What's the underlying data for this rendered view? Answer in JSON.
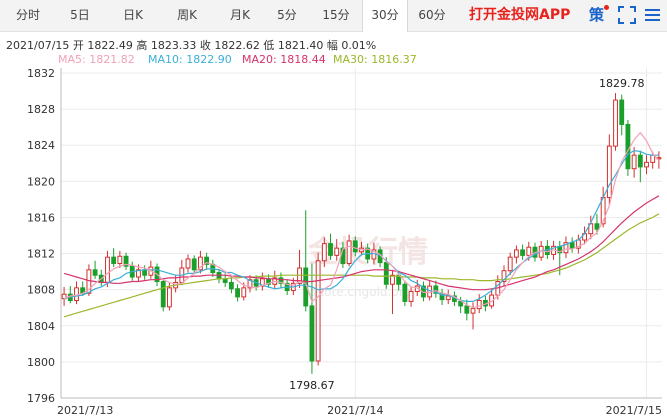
{
  "tabs": [
    {
      "label": "分时",
      "active": false
    },
    {
      "label": "5日",
      "active": false
    },
    {
      "label": "日K",
      "active": false
    },
    {
      "label": "周K",
      "active": false
    },
    {
      "label": "月K",
      "active": false
    },
    {
      "label": "5分",
      "active": false
    },
    {
      "label": "15分",
      "active": false
    },
    {
      "label": "30分",
      "active": true
    },
    {
      "label": "60分",
      "active": false
    }
  ],
  "brand": "打开金投网APP",
  "strategy_label": "策",
  "quote_line": "2021/07/15  开 1822.49  高 1823.33  收 1822.62  低 1821.40  幅 0.01%",
  "ma_legend": [
    {
      "label": "MA5: 1821.82",
      "color": "#f2a2b8"
    },
    {
      "label": "MA10: 1822.90",
      "color": "#3ab0d8"
    },
    {
      "label": "MA20: 1818.44",
      "color": "#d6336c"
    },
    {
      "label": "MA30: 1816.37",
      "color": "#9cb82c"
    }
  ],
  "watermark": {
    "text": "金投行情",
    "subtext": "quote.cngold.org"
  },
  "colors": {
    "up": "#d32f2f",
    "down": "#1a9f2a",
    "grid": "#ebebeb"
  },
  "chart_data": {
    "type": "candlestick",
    "ylim": [
      1796,
      1832
    ],
    "y_ticks": [
      "1832",
      "1828",
      "1824",
      "1820",
      "1816",
      "1812",
      "1808",
      "1804",
      "1800",
      "1796"
    ],
    "y_tick_values": [
      1832,
      1828,
      1824,
      1820,
      1816,
      1812,
      1808,
      1804,
      1800,
      1796
    ],
    "x_tick_labels": [
      "2021/7/13",
      "2021/7/14",
      "2021/7/15"
    ],
    "x_tick_index": [
      0,
      47,
      94
    ],
    "annotations": [
      {
        "text": "1829.78",
        "index": 90,
        "value": 1829.78
      },
      {
        "text": "1798.67",
        "index": 40,
        "value": 1798.67
      }
    ],
    "candles": [
      [
        1807.0,
        1807.5,
        1808.3,
        1806.2
      ],
      [
        1807.5,
        1806.8,
        1808.4,
        1806.5
      ],
      [
        1806.8,
        1808.2,
        1808.9,
        1806.4
      ],
      [
        1808.2,
        1807.6,
        1808.9,
        1807.3
      ],
      [
        1807.6,
        1810.2,
        1810.8,
        1807.3
      ],
      [
        1810.2,
        1809.6,
        1811.2,
        1809.2
      ],
      [
        1809.6,
        1808.8,
        1810.2,
        1808.4
      ],
      [
        1808.8,
        1811.6,
        1812.3,
        1808.3
      ],
      [
        1811.6,
        1810.9,
        1812.6,
        1810.5
      ],
      [
        1810.9,
        1811.7,
        1812.3,
        1810.4
      ],
      [
        1811.7,
        1810.6,
        1812.1,
        1810.2
      ],
      [
        1810.6,
        1809.4,
        1811.1,
        1809.0
      ],
      [
        1809.4,
        1810.2,
        1810.8,
        1808.9
      ],
      [
        1810.2,
        1809.6,
        1810.7,
        1809.1
      ],
      [
        1809.6,
        1810.5,
        1811.2,
        1809.2
      ],
      [
        1810.5,
        1808.9,
        1810.9,
        1808.4
      ],
      [
        1808.9,
        1806.1,
        1809.3,
        1805.6
      ],
      [
        1806.1,
        1808.2,
        1808.8,
        1805.7
      ],
      [
        1808.2,
        1808.8,
        1809.6,
        1807.7
      ],
      [
        1808.8,
        1810.4,
        1811.3,
        1808.5
      ],
      [
        1810.4,
        1811.4,
        1811.9,
        1809.9
      ],
      [
        1811.4,
        1810.2,
        1811.8,
        1809.7
      ],
      [
        1810.2,
        1811.6,
        1812.3,
        1809.8
      ],
      [
        1811.6,
        1810.8,
        1812.1,
        1810.2
      ],
      [
        1810.8,
        1809.9,
        1811.3,
        1809.4
      ],
      [
        1809.9,
        1809.2,
        1810.3,
        1808.7
      ],
      [
        1809.2,
        1808.8,
        1809.8,
        1808.3
      ],
      [
        1808.8,
        1808.1,
        1809.4,
        1807.6
      ],
      [
        1808.1,
        1807.2,
        1808.6,
        1806.7
      ],
      [
        1807.2,
        1808.2,
        1808.8,
        1806.8
      ],
      [
        1808.2,
        1809.1,
        1809.6,
        1807.7
      ],
      [
        1809.1,
        1808.4,
        1809.6,
        1807.9
      ],
      [
        1808.4,
        1809.2,
        1809.9,
        1807.9
      ],
      [
        1809.2,
        1808.6,
        1809.7,
        1808.2
      ],
      [
        1808.6,
        1809.3,
        1810.1,
        1808.1
      ],
      [
        1809.3,
        1808.7,
        1809.9,
        1808.2
      ],
      [
        1808.7,
        1807.9,
        1809.1,
        1807.4
      ],
      [
        1807.9,
        1808.7,
        1809.3,
        1807.4
      ],
      [
        1808.7,
        1810.4,
        1812.4,
        1808.2
      ],
      [
        1810.4,
        1806.2,
        1816.8,
        1805.6
      ],
      [
        1806.2,
        1800.1,
        1810.9,
        1798.67
      ],
      [
        1800.1,
        1811.2,
        1812.1,
        1799.6
      ],
      [
        1811.2,
        1813.1,
        1813.8,
        1810.5
      ],
      [
        1813.1,
        1811.8,
        1814.2,
        1811.3
      ],
      [
        1811.8,
        1812.6,
        1813.6,
        1811.2
      ],
      [
        1812.6,
        1810.9,
        1813.3,
        1810.4
      ],
      [
        1810.9,
        1813.4,
        1814.1,
        1810.6
      ],
      [
        1813.4,
        1812.2,
        1813.9,
        1811.7
      ],
      [
        1812.2,
        1812.6,
        1813.3,
        1811.8
      ],
      [
        1812.6,
        1811.4,
        1813.1,
        1810.9
      ],
      [
        1811.4,
        1812.4,
        1813.2,
        1810.8
      ],
      [
        1812.4,
        1811.0,
        1812.8,
        1810.5
      ],
      [
        1811.0,
        1808.6,
        1811.6,
        1808.1
      ],
      [
        1808.6,
        1809.6,
        1810.2,
        1805.3
      ],
      [
        1809.6,
        1808.6,
        1810.1,
        1807.9
      ],
      [
        1808.6,
        1806.7,
        1809.0,
        1806.2
      ],
      [
        1806.7,
        1807.8,
        1808.4,
        1806.1
      ],
      [
        1807.8,
        1808.4,
        1809.1,
        1807.3
      ],
      [
        1808.4,
        1807.2,
        1808.9,
        1806.7
      ],
      [
        1807.2,
        1808.4,
        1809.0,
        1806.8
      ],
      [
        1808.4,
        1807.6,
        1809.0,
        1807.1
      ],
      [
        1807.6,
        1806.9,
        1808.1,
        1806.3
      ],
      [
        1806.9,
        1807.3,
        1808.0,
        1806.4
      ],
      [
        1807.3,
        1806.7,
        1807.8,
        1806.2
      ],
      [
        1806.7,
        1806.2,
        1807.2,
        1805.4
      ],
      [
        1806.2,
        1805.4,
        1806.9,
        1804.6
      ],
      [
        1805.4,
        1805.9,
        1806.6,
        1803.6
      ],
      [
        1805.9,
        1806.8,
        1807.5,
        1805.4
      ],
      [
        1806.8,
        1806.2,
        1807.3,
        1805.6
      ],
      [
        1806.2,
        1807.4,
        1808.0,
        1805.9
      ],
      [
        1807.4,
        1808.9,
        1809.6,
        1806.9
      ],
      [
        1808.9,
        1810.1,
        1810.7,
        1808.4
      ],
      [
        1810.1,
        1811.6,
        1812.1,
        1809.6
      ],
      [
        1811.6,
        1812.4,
        1812.9,
        1810.9
      ],
      [
        1812.4,
        1811.8,
        1813.0,
        1811.3
      ],
      [
        1811.8,
        1812.7,
        1813.3,
        1811.2
      ],
      [
        1812.7,
        1811.6,
        1813.2,
        1811.1
      ],
      [
        1811.6,
        1812.8,
        1813.4,
        1811.2
      ],
      [
        1812.8,
        1811.9,
        1813.5,
        1811.4
      ],
      [
        1811.9,
        1812.8,
        1813.4,
        1811.3
      ],
      [
        1812.8,
        1812.1,
        1813.4,
        1809.6
      ],
      [
        1812.1,
        1813.2,
        1813.9,
        1811.5
      ],
      [
        1813.2,
        1812.6,
        1813.8,
        1812.1
      ],
      [
        1812.6,
        1813.5,
        1814.1,
        1812.0
      ],
      [
        1813.5,
        1814.2,
        1815.0,
        1813.0
      ],
      [
        1814.2,
        1815.3,
        1816.2,
        1813.6
      ],
      [
        1815.3,
        1814.7,
        1816.4,
        1814.1
      ],
      [
        1815.3,
        1818.2,
        1819.4,
        1814.9
      ],
      [
        1818.2,
        1823.9,
        1825.2,
        1817.4
      ],
      [
        1823.9,
        1829.0,
        1829.78,
        1823.4
      ],
      [
        1829.0,
        1826.3,
        1829.6,
        1825.1
      ],
      [
        1826.3,
        1821.4,
        1826.8,
        1820.6
      ],
      [
        1821.4,
        1822.9,
        1823.8,
        1820.4
      ],
      [
        1822.9,
        1821.6,
        1823.4,
        1819.9
      ],
      [
        1821.6,
        1822.1,
        1822.9,
        1820.8
      ],
      [
        1822.1,
        1822.9,
        1823.3,
        1821.4
      ],
      [
        1822.49,
        1822.62,
        1823.33,
        1821.4
      ]
    ],
    "ma5": [
      1807.0,
      1807.3,
      1807.4,
      1807.6,
      1808.0,
      1808.7,
      1809.2,
      1809.8,
      1810.3,
      1810.6,
      1810.8,
      1810.7,
      1810.5,
      1810.4,
      1810.1,
      1809.7,
      1809.1,
      1808.8,
      1808.6,
      1808.7,
      1809.3,
      1809.8,
      1810.5,
      1811.0,
      1810.8,
      1810.5,
      1810.0,
      1809.6,
      1809.0,
      1808.5,
      1808.3,
      1808.2,
      1808.5,
      1808.7,
      1808.9,
      1808.8,
      1808.6,
      1808.5,
      1808.9,
      1808.7,
      1806.7,
      1807.2,
      1808.1,
      1808.5,
      1810.2,
      1812.5,
      1812.8,
      1812.6,
      1812.4,
      1812.5,
      1812.2,
      1811.9,
      1811.1,
      1810.6,
      1809.7,
      1808.9,
      1808.3,
      1808.2,
      1807.7,
      1807.7,
      1807.9,
      1807.6,
      1807.5,
      1807.2,
      1806.8,
      1806.3,
      1806.0,
      1806.2,
      1806.4,
      1806.7,
      1807.3,
      1808.0,
      1809.1,
      1810.2,
      1811.0,
      1811.7,
      1812.1,
      1812.3,
      1812.2,
      1812.4,
      1812.2,
      1812.5,
      1812.5,
      1812.8,
      1813.1,
      1813.8,
      1814.3,
      1815.6,
      1817.3,
      1820.2,
      1822.2,
      1823.4,
      1824.6,
      1825.4,
      1824.5,
      1823.1,
      1822.3
    ],
    "ma10": [
      1807.0,
      1807.2,
      1807.3,
      1807.4,
      1807.7,
      1808.1,
      1808.3,
      1808.7,
      1809.1,
      1809.3,
      1809.8,
      1810.0,
      1810.1,
      1810.2,
      1810.2,
      1810.2,
      1810.0,
      1809.8,
      1809.6,
      1809.6,
      1809.8,
      1809.8,
      1810.0,
      1810.3,
      1810.3,
      1810.2,
      1809.9,
      1809.9,
      1809.6,
      1809.4,
      1809.0,
      1808.8,
      1808.5,
      1808.3,
      1808.1,
      1808.2,
      1808.3,
      1808.3,
      1808.5,
      1808.5,
      1808.3,
      1808.0,
      1808.1,
      1808.1,
      1808.5,
      1809.2,
      1810.3,
      1811.2,
      1811.9,
      1812.0,
      1812.0,
      1811.8,
      1811.2,
      1810.6,
      1809.9,
      1809.6,
      1809.0,
      1808.7,
      1808.2,
      1807.9,
      1807.7,
      1807.4,
      1807.4,
      1807.1,
      1806.8,
      1806.7,
      1806.7,
      1807.0,
      1807.4,
      1807.9,
      1808.5,
      1809.1,
      1809.8,
      1810.4,
      1811.0,
      1811.5,
      1811.9,
      1812.3,
      1812.4,
      1812.6,
      1812.8,
      1813.0,
      1813.3,
      1813.5,
      1814.2,
      1815.4,
      1816.8,
      1818.2,
      1819.6,
      1820.7,
      1821.9,
      1823.0,
      1823.4,
      1823.3,
      1823.0,
      1822.9,
      1822.9
    ],
    "ma20": [
      1809.8,
      1809.6,
      1809.4,
      1809.2,
      1809.0,
      1808.9,
      1808.8,
      1808.8,
      1808.7,
      1808.7,
      1808.8,
      1808.9,
      1808.9,
      1809.0,
      1809.1,
      1809.1,
      1809.2,
      1809.3,
      1809.3,
      1809.4,
      1809.4,
      1809.5,
      1809.5,
      1809.6,
      1809.6,
      1809.6,
      1809.6,
      1809.5,
      1809.5,
      1809.4,
      1809.4,
      1809.3,
      1809.3,
      1809.2,
      1809.2,
      1809.1,
      1809.1,
      1809.0,
      1809.0,
      1808.9,
      1808.9,
      1809.0,
      1809.1,
      1809.2,
      1809.3,
      1809.4,
      1809.6,
      1809.8,
      1810.0,
      1810.1,
      1810.2,
      1810.2,
      1810.2,
      1810.1,
      1810.0,
      1809.8,
      1809.6,
      1809.4,
      1809.2,
      1809.0,
      1808.8,
      1808.6,
      1808.4,
      1808.3,
      1808.2,
      1808.1,
      1808.0,
      1808.0,
      1808.0,
      1808.1,
      1808.2,
      1808.4,
      1808.6,
      1808.8,
      1809.0,
      1809.2,
      1809.4,
      1809.7,
      1810.0,
      1810.2,
      1810.5,
      1810.8,
      1811.1,
      1811.4,
      1811.8,
      1812.2,
      1812.7,
      1813.3,
      1814.0,
      1814.7,
      1815.4,
      1816.0,
      1816.6,
      1817.1,
      1817.6,
      1818.0,
      1818.4
    ],
    "ma30": [
      1805.0,
      1805.2,
      1805.4,
      1805.6,
      1805.8,
      1806.0,
      1806.2,
      1806.4,
      1806.6,
      1806.8,
      1807.0,
      1807.2,
      1807.4,
      1807.6,
      1807.8,
      1808.0,
      1808.2,
      1808.4,
      1808.5,
      1808.6,
      1808.7,
      1808.8,
      1808.9,
      1809.0,
      1809.1,
      1809.2,
      1809.2,
      1809.3,
      1809.3,
      1809.4,
      1809.4,
      1809.4,
      1809.5,
      1809.5,
      1809.5,
      1809.6,
      1809.6,
      1809.6,
      1809.6,
      1809.6,
      1809.6,
      1809.6,
      1809.6,
      1809.6,
      1809.6,
      1809.6,
      1809.6,
      1809.6,
      1809.6,
      1809.6,
      1809.5,
      1809.5,
      1809.5,
      1809.5,
      1809.5,
      1809.4,
      1809.4,
      1809.4,
      1809.3,
      1809.3,
      1809.3,
      1809.2,
      1809.2,
      1809.2,
      1809.1,
      1809.1,
      1809.1,
      1809.0,
      1809.0,
      1809.0,
      1809.1,
      1809.1,
      1809.2,
      1809.3,
      1809.4,
      1809.5,
      1809.6,
      1809.7,
      1809.8,
      1810.0,
      1810.2,
      1810.4,
      1810.7,
      1811.0,
      1811.3,
      1811.7,
      1812.1,
      1812.6,
      1813.1,
      1813.6,
      1814.1,
      1814.6,
      1815.0,
      1815.4,
      1815.7,
      1816.0,
      1816.4
    ]
  }
}
